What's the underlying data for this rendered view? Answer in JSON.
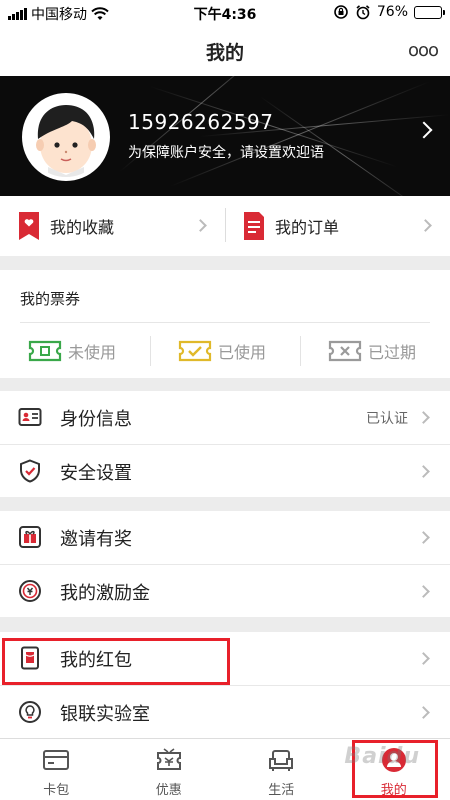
{
  "status_bar": {
    "carrier": "中国移动",
    "time": "下午4:36",
    "battery_text": "76%",
    "battery_level": 0.76
  },
  "nav": {
    "title": "我的",
    "more": "ooo"
  },
  "profile": {
    "phone": "15926262597",
    "greeting": "为保障账户安全，请设置欢迎语"
  },
  "quick": {
    "favorites": "我的收藏",
    "orders": "我的订单"
  },
  "coupons": {
    "title": "我的票券",
    "unused": "未使用",
    "used": "已使用",
    "expired": "已过期",
    "colors": {
      "unused": "#3aa84a",
      "used": "#e0b92a",
      "expired": "#9a9a9a"
    }
  },
  "menu": {
    "identity": {
      "label": "身份信息",
      "status": "已认证"
    },
    "security": {
      "label": "安全设置"
    },
    "invite": {
      "label": "邀请有奖"
    },
    "incentive": {
      "label": "我的激励金"
    },
    "red_packet": {
      "label": "我的红包"
    },
    "lab": {
      "label": "银联实验室"
    }
  },
  "tabs": {
    "card": "卡包",
    "deals": "优惠",
    "life": "生活",
    "mine": "我的"
  },
  "watermark": "Baidu",
  "colors": {
    "accent": "#d92a35",
    "highlight": "#e8202a"
  }
}
